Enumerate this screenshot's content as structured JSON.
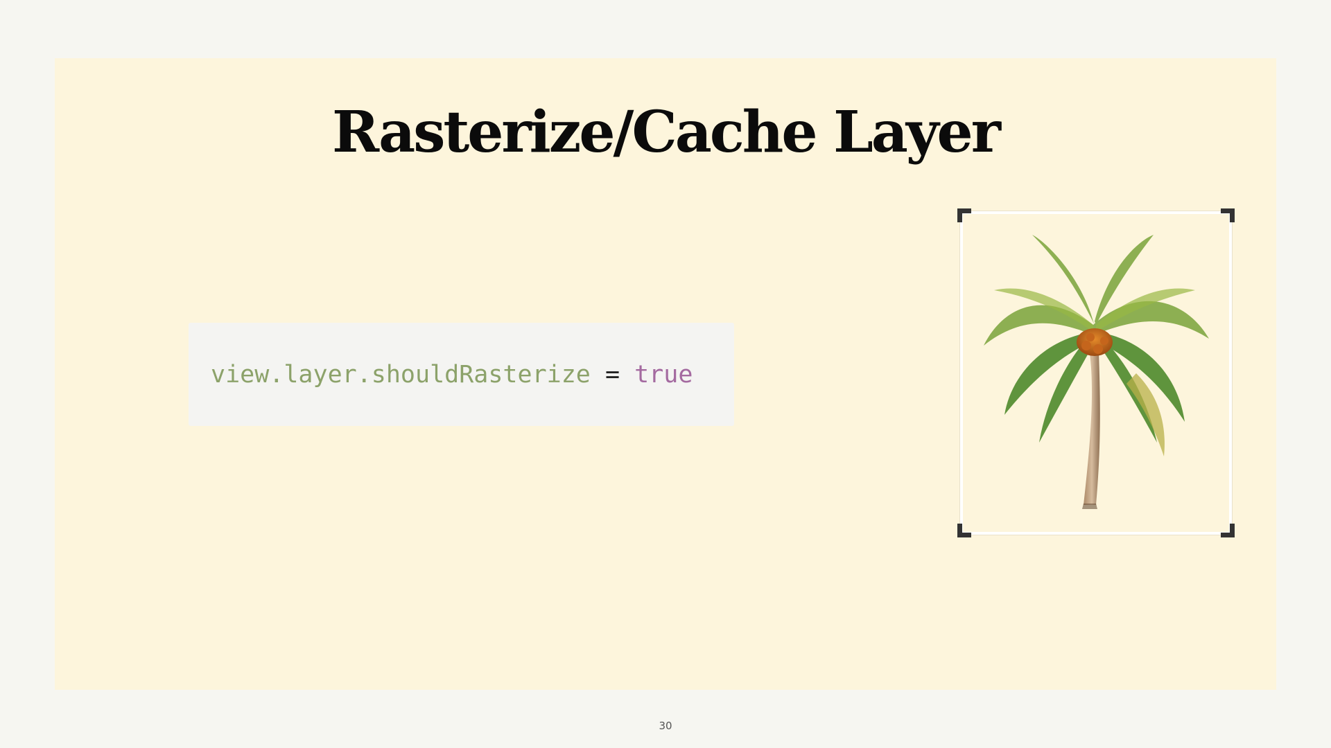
{
  "slide": {
    "title": "Rasterize/Cache Layer",
    "code": {
      "identifier": "view.layer.shouldRasterize",
      "operator": "=",
      "value": "true"
    },
    "image": {
      "subject": "palm-tree",
      "icon": "palm-tree-illustration"
    },
    "page_number": "30"
  },
  "colors": {
    "page_background": "#f6f6f1",
    "slide_background": "#fdf5dc",
    "code_background": "#f4f4f2",
    "code_identifier": "#8ca26a",
    "code_keyword": "#a46aa0",
    "title": "#0b0b0b"
  }
}
